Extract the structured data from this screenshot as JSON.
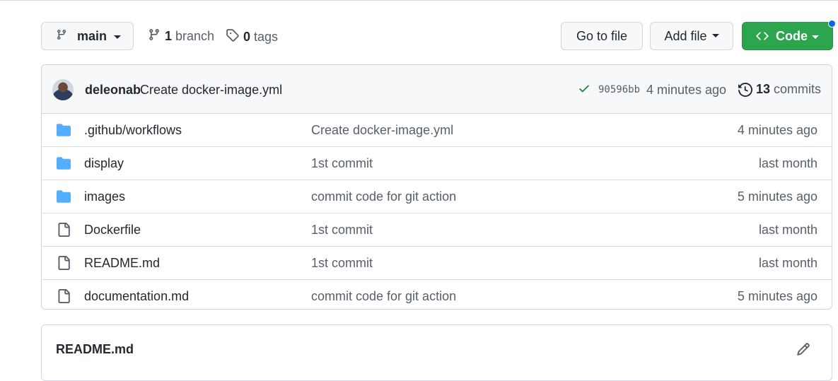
{
  "branch_selector": {
    "label": "main"
  },
  "branch_count": {
    "count": "1",
    "label": "branch"
  },
  "tag_count": {
    "count": "0",
    "label": "tags"
  },
  "buttons": {
    "goto_file": "Go to file",
    "add_file": "Add file",
    "code": "Code"
  },
  "latest_commit": {
    "author": "deleonab",
    "message": "Create docker-image.yml",
    "sha": "90596bb",
    "time": "4 minutes ago",
    "commit_count": "13",
    "commits_label": "commits",
    "status": "success"
  },
  "files": [
    {
      "type": "folder",
      "name": ".github/workflows",
      "message": "Create docker-image.yml",
      "time": "4 minutes ago"
    },
    {
      "type": "folder",
      "name": "display",
      "message": "1st commit",
      "time": "last month"
    },
    {
      "type": "folder",
      "name": "images",
      "message": "commit code for git action",
      "time": "5 minutes ago"
    },
    {
      "type": "file",
      "name": "Dockerfile",
      "message": "1st commit",
      "time": "last month"
    },
    {
      "type": "file",
      "name": "README.md",
      "message": "1st commit",
      "time": "last month"
    },
    {
      "type": "file",
      "name": "documentation.md",
      "message": "commit code for git action",
      "time": "5 minutes ago"
    }
  ],
  "readme": {
    "title": "README.md"
  },
  "colors": {
    "accent_green": "#2da44e",
    "folder_blue": "#54aeff",
    "link_blue": "#0969da",
    "muted": "#57606a"
  }
}
